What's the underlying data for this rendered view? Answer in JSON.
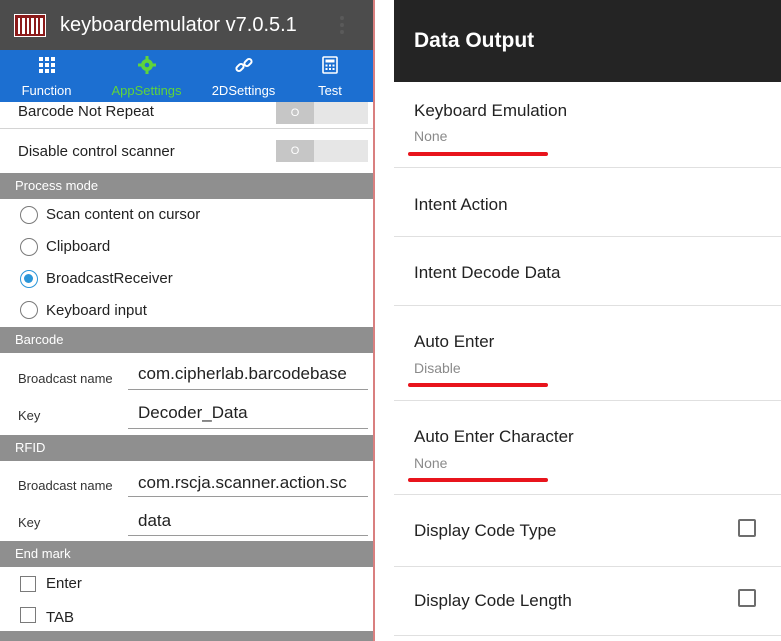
{
  "left_app": {
    "title": "keyboardemulator v7.0.5.1",
    "tabs": [
      {
        "label": "Function",
        "icon": "grid-icon"
      },
      {
        "label": "AppSettings",
        "icon": "gear-icon"
      },
      {
        "label": "2DSettings",
        "icon": "link-icon"
      },
      {
        "label": "Test",
        "icon": "calculator-icon"
      }
    ],
    "active_tab": "AppSettings",
    "toggles": [
      {
        "label": "Barcode Not Repeat",
        "state": "O"
      },
      {
        "label": "Disable control scanner",
        "state": "O"
      }
    ],
    "process_mode": {
      "header": "Process mode",
      "options": [
        "Scan content on cursor",
        "Clipboard",
        "BroadcastReceiver",
        "Keyboard input"
      ],
      "selected": "BroadcastReceiver"
    },
    "barcode": {
      "header": "Barcode",
      "broadcast_label": "Broadcast name",
      "broadcast_value": "com.cipherlab.barcodebase",
      "key_label": "Key",
      "key_value": "Decoder_Data"
    },
    "rfid": {
      "header": "RFID",
      "broadcast_label": "Broadcast name",
      "broadcast_value": "com.rscja.scanner.action.sc",
      "key_label": "Key",
      "key_value": "data"
    },
    "end_mark": {
      "header": "End mark",
      "options": [
        {
          "label": "Enter",
          "checked": false
        },
        {
          "label": "TAB",
          "checked": false
        }
      ]
    },
    "colors": {
      "titlebar": "#4c4c4c",
      "tabbar": "#1c6fd1",
      "active_tab": "#5fd43a",
      "section": "#8f8f8f",
      "radio_selected": "#2b96d9"
    }
  },
  "right_app": {
    "title": "Data Output",
    "prefs": [
      {
        "title": "Keyboard Emulation",
        "summary": "None"
      },
      {
        "title": "Intent Action",
        "summary": ""
      },
      {
        "title": "Intent Decode Data",
        "summary": ""
      },
      {
        "title": "Auto Enter",
        "summary": "Disable"
      },
      {
        "title": "Auto Enter Character",
        "summary": "None"
      },
      {
        "title": "Display Code Type",
        "checked": false
      },
      {
        "title": "Display Code Length",
        "checked": false
      }
    ],
    "colors": {
      "header": "#242424",
      "annotation": "#e8141c"
    }
  }
}
